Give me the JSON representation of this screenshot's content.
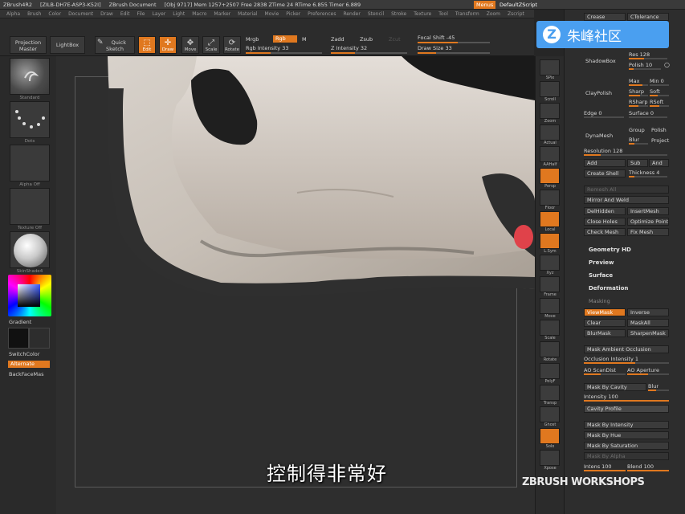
{
  "titlebar": {
    "app": "ZBrush4R2",
    "build": "[ZILB-DH7E-ASP3-K52I]",
    "document": "ZBrush Document",
    "stats": "[Obj 9717] Mem 1257+2507 Free 2838 ZTime 24 RTime 6.855 Timer 6.889",
    "menus": "Menus",
    "script": "DefaultZScript"
  },
  "menubar": [
    "Alpha",
    "Brush",
    "Color",
    "Document",
    "Draw",
    "Edit",
    "File",
    "Layer",
    "Light",
    "Macro",
    "Marker",
    "Material",
    "Movie",
    "Picker",
    "Preferences",
    "Render",
    "Stencil",
    "Stroke",
    "Texture",
    "Tool",
    "Transform",
    "Zoom",
    "Zscript"
  ],
  "toolbar": {
    "projection_master": "Projection Master",
    "lightbox": "LightBox",
    "quick_sketch": "Quick Sketch",
    "edit": "Edit",
    "draw": "Draw",
    "move": "Move",
    "scale": "Scale",
    "rotate": "Rotate",
    "mrgb": "Mrgb",
    "rgb": "Rgb",
    "m": "M",
    "rgb_intensity": "Rgb Intensity 33",
    "zadd": "Zadd",
    "zsub": "Zsub",
    "zcut": "Zcut",
    "z_intensity": "Z Intensity 32",
    "focal_shift": "Focal Shift -45",
    "draw_size": "Draw Size 33",
    "rgb_intensity_pct": 0.33,
    "z_intensity_pct": 0.32,
    "focal_shift_pct": 0.55,
    "draw_size_pct": 0.25
  },
  "leftshelf": {
    "brush_label": "Standard",
    "stroke_label": "Dots",
    "alpha_label": "Alpha Off",
    "texture_label": "Texture Off",
    "material_label": "SkinShade4",
    "gradient": "Gradient",
    "switch_color": "SwitchColor",
    "alternate": "Alternate",
    "backface": "BackFaceMas"
  },
  "rightshelf": [
    "SPix",
    "Scroll",
    "Zoom",
    "Actual",
    "AAHalf",
    "Persp",
    "Floor",
    "Local",
    "L.Sym",
    "Xyz",
    "Frame",
    "Move",
    "Scale",
    "Rotate",
    "PolyF",
    "Transp",
    "Ghost",
    "Solo",
    "Xpose"
  ],
  "rightpanel": {
    "crease": "Crease",
    "ctolerance": "CTolerance",
    "shadowbox": "ShadowBox",
    "res": "Res 128",
    "polish_val": "Polish 10",
    "claypolish": "ClayPolish",
    "max": "Max",
    "min": "Min 0",
    "sharp": "Sharp",
    "soft": "Soft",
    "rsharp": "RSharp",
    "rsoft": "RSoft",
    "edge": "Edge 0",
    "surface": "Surface 0",
    "dynamesh": "DynaMesh",
    "group": "Group",
    "polish": "Polish",
    "blur": "Blur",
    "project": "Project",
    "resolution": "Resolution 128",
    "add": "Add",
    "sub": "Sub",
    "and": "And",
    "create_shell": "Create Shell",
    "thickness": "Thickness 4",
    "remesh_all": "Remesh All",
    "mirror_weld": "Mirror And Weld",
    "delhidden": "DelHidden",
    "insertmesh": "InsertMesh",
    "close_holes": "Close Holes",
    "optimize": "Optimize Points",
    "check_mesh": "Check Mesh",
    "fix_mesh": "Fix Mesh",
    "geometry_hd": "Geometry HD",
    "preview": "Preview",
    "surface_head": "Surface",
    "deformation": "Deformation",
    "masking": "Masking",
    "viewmask": "ViewMask",
    "inverse": "Inverse",
    "clear": "Clear",
    "maskall": "MaskAll",
    "blurmask": "BlurMask",
    "sharpenmask": "SharpenMask",
    "mask_ao": "Mask Ambient Occlusion",
    "occlusion_intensity": "Occlusion Intensity 1",
    "ao_scandist": "AO ScanDist",
    "ao_aperture": "AO Aperture",
    "mask_by_cavity": "Mask By Cavity",
    "blur_val": "Blur",
    "intensity_100": "Intensity 100",
    "cavity_profile": "Cavity Profile",
    "mask_by_intensity": "Mask By Intensity",
    "mask_by_hue": "Mask By Hue",
    "mask_by_saturation": "Mask By Saturation",
    "mask_by_alpha": "Mask By Alpha",
    "intens_100": "Intens 100",
    "blend_100": "Blend 100"
  },
  "overlay": {
    "watermark_site": "朱峰社区",
    "watermark_logo": "Z",
    "subtitle": "控制得非常好",
    "workshops": "ZBRUSH WORKSHOPS"
  },
  "colors": {
    "accent": "#e0781f",
    "watermark": "#4a9ff0"
  }
}
